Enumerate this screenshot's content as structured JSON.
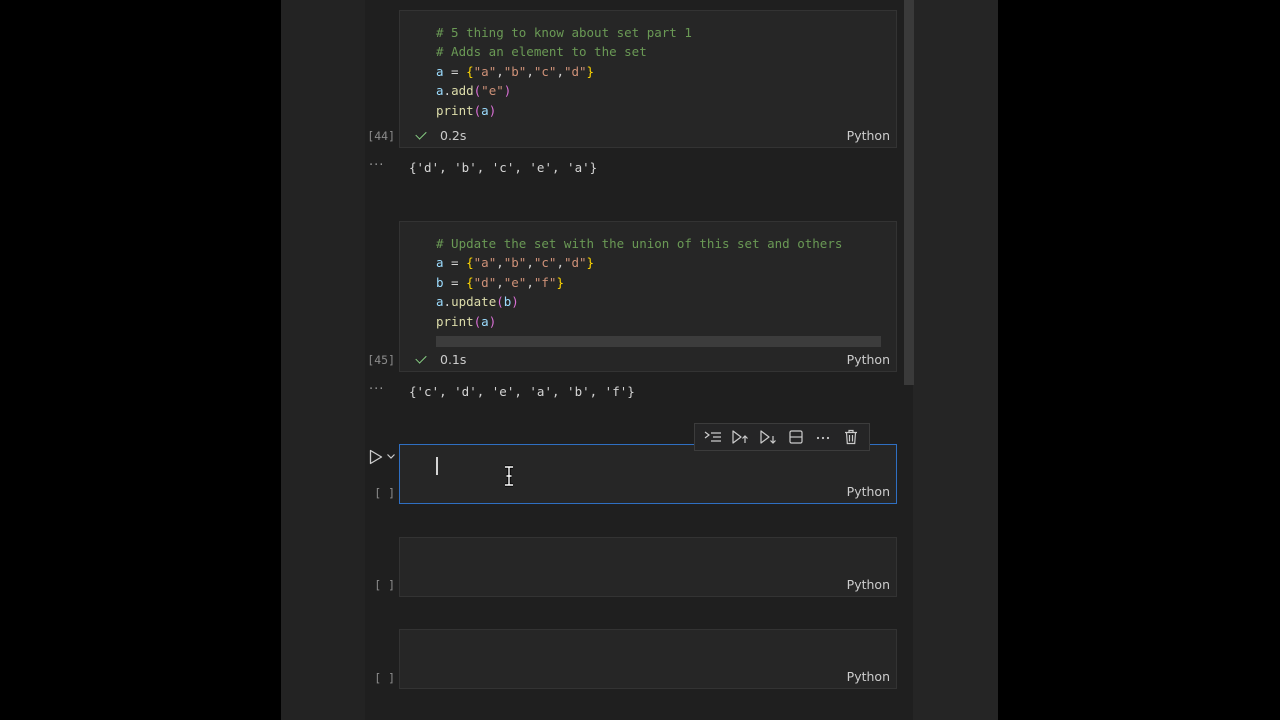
{
  "cells": [
    {
      "type": "code",
      "exec_count": "[44]",
      "lines": [
        [
          {
            "t": "# 5 thing to know about set part 1",
            "c": "comment"
          }
        ],
        [
          {
            "t": "# Adds an element to the set",
            "c": "comment"
          }
        ],
        [
          {
            "t": "a",
            "c": "var"
          },
          {
            "t": " = ",
            "c": "op"
          },
          {
            "t": "{",
            "c": "brace"
          },
          {
            "t": "\"a\"",
            "c": "str"
          },
          {
            "t": ",",
            "c": "op"
          },
          {
            "t": "\"b\"",
            "c": "str"
          },
          {
            "t": ",",
            "c": "op"
          },
          {
            "t": "\"c\"",
            "c": "str"
          },
          {
            "t": ",",
            "c": "op"
          },
          {
            "t": "\"d\"",
            "c": "str"
          },
          {
            "t": "}",
            "c": "brace"
          }
        ],
        [
          {
            "t": "a",
            "c": "var"
          },
          {
            "t": ".",
            "c": "op"
          },
          {
            "t": "add",
            "c": "fn"
          },
          {
            "t": "(",
            "c": "paren"
          },
          {
            "t": "\"e\"",
            "c": "str"
          },
          {
            "t": ")",
            "c": "paren"
          }
        ],
        [
          {
            "t": "print",
            "c": "fn"
          },
          {
            "t": "(",
            "c": "paren"
          },
          {
            "t": "a",
            "c": "var"
          },
          {
            "t": ")",
            "c": "paren"
          }
        ]
      ],
      "status_time": "0.2s",
      "language": "Python",
      "output": "{'d', 'b', 'c', 'e', 'a'}"
    },
    {
      "type": "code",
      "exec_count": "[45]",
      "lines": [
        [
          {
            "t": "# Update the set with the union of this set and others",
            "c": "comment"
          }
        ],
        [
          {
            "t": "a",
            "c": "var"
          },
          {
            "t": " = ",
            "c": "op"
          },
          {
            "t": "{",
            "c": "brace"
          },
          {
            "t": "\"a\"",
            "c": "str"
          },
          {
            "t": ",",
            "c": "op"
          },
          {
            "t": "\"b\"",
            "c": "str"
          },
          {
            "t": ",",
            "c": "op"
          },
          {
            "t": "\"c\"",
            "c": "str"
          },
          {
            "t": ",",
            "c": "op"
          },
          {
            "t": "\"d\"",
            "c": "str"
          },
          {
            "t": "}",
            "c": "brace"
          }
        ],
        [
          {
            "t": "b",
            "c": "var"
          },
          {
            "t": " = ",
            "c": "op"
          },
          {
            "t": "{",
            "c": "brace"
          },
          {
            "t": "\"d\"",
            "c": "str"
          },
          {
            "t": ",",
            "c": "op"
          },
          {
            "t": "\"e\"",
            "c": "str"
          },
          {
            "t": ",",
            "c": "op"
          },
          {
            "t": "\"f\"",
            "c": "str"
          },
          {
            "t": "}",
            "c": "brace"
          }
        ],
        [
          {
            "t": "a",
            "c": "var"
          },
          {
            "t": ".",
            "c": "op"
          },
          {
            "t": "update",
            "c": "fn"
          },
          {
            "t": "(",
            "c": "paren"
          },
          {
            "t": "b",
            "c": "var"
          },
          {
            "t": ")",
            "c": "paren"
          }
        ],
        [
          {
            "t": "print",
            "c": "fn"
          },
          {
            "t": "(",
            "c": "paren"
          },
          {
            "t": "a",
            "c": "var"
          },
          {
            "t": ")",
            "c": "paren"
          }
        ]
      ],
      "status_time": "0.1s",
      "language": "Python",
      "output": "{'c', 'd', 'e', 'a', 'b', 'f'}"
    },
    {
      "type": "code",
      "exec_count": "[ ]",
      "language": "Python"
    },
    {
      "type": "code",
      "exec_count": "[ ]",
      "language": "Python"
    },
    {
      "type": "code",
      "exec_count": "[ ]",
      "language": "Python"
    }
  ],
  "output_ellipsis": "···",
  "colors": {
    "comment": "#6a9955",
    "var": "#9cdcfe",
    "str": "#ce9178",
    "brace": "#ffd700",
    "paren": "#da70d6",
    "fn": "#dcdcaa",
    "op": "#d4d4d4",
    "focus_border": "#2f6fc2",
    "success": "#89d185"
  },
  "icons": {
    "cell_toolbar": [
      "run-by-line-icon",
      "execute-above-icon",
      "execute-below-icon",
      "split-cell-icon",
      "more-actions-icon",
      "delete-cell-icon"
    ],
    "run": "run-cell-icon",
    "chevron": "chevron-down-icon",
    "cursor": "text-ibeam-cursor-icon"
  }
}
